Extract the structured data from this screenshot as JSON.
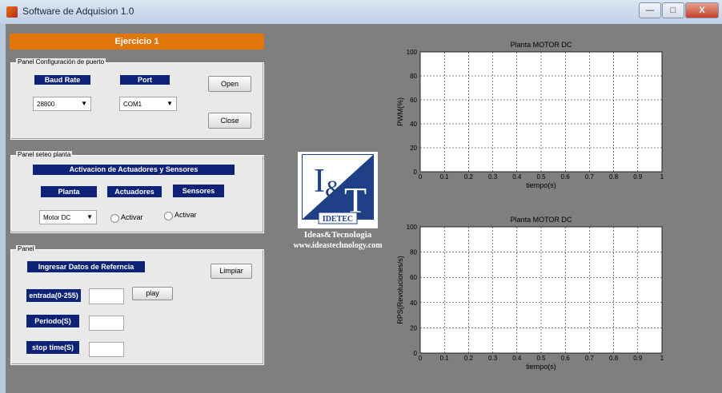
{
  "window": {
    "title": "Software de Adquision  1.0",
    "minimize": "—",
    "maximize": "□",
    "close": "X"
  },
  "banner": {
    "label": "Ejercicio 1"
  },
  "port_panel": {
    "title": "Panel Configuración de puerto",
    "baud_label": "Baud Rate",
    "port_label": "Port",
    "baud_value": "28800",
    "port_value": "COM1",
    "open_label": "Open",
    "close_label": "Close"
  },
  "plant_panel": {
    "title": "Panel seteo planta",
    "header": "Activacion de Actuadores y Sensores",
    "planta_label": "Planta",
    "actuadores_label": "Actuadores",
    "sensores_label": "Sensores",
    "planta_value": "Motor DC",
    "activar1": "Activar",
    "activar2": "Activar"
  },
  "data_panel": {
    "title": "Panel",
    "header": "Ingresar Datos de Referncia",
    "limpiar_label": "Limpiar",
    "entrada_label": "entrada(0-255)",
    "play_label": "play",
    "periodo_label": "Periodo(S)",
    "stop_label": "stop time(S)"
  },
  "logo": {
    "mark": "I&T",
    "inner_text": "IDETEC",
    "caption1": "Ideas&Tecnologia",
    "caption2": "www.ideastechnology.com"
  },
  "chart_data": [
    {
      "type": "line",
      "title": "Planta MOTOR DC",
      "xlabel": "tiempo(s)",
      "ylabel": "PWM(%)",
      "xlim": [
        0,
        1
      ],
      "ylim": [
        0,
        100
      ],
      "x_ticks": [
        "0",
        "0.1",
        "0.2",
        "0.3",
        "0.4",
        "0.5",
        "0.6",
        "0.7",
        "0.8",
        "0.9",
        "1"
      ],
      "y_ticks": [
        "0",
        "20",
        "40",
        "60",
        "80",
        "100"
      ],
      "grid": true,
      "series": []
    },
    {
      "type": "line",
      "title": "Planta MOTOR DC",
      "xlabel": "tiempo(s)",
      "ylabel": "RPS(Revoluciones/s)",
      "xlim": [
        0,
        1
      ],
      "ylim": [
        0,
        100
      ],
      "x_ticks": [
        "0",
        "0.1",
        "0.2",
        "0.3",
        "0.4",
        "0.5",
        "0.6",
        "0.7",
        "0.8",
        "0.9",
        "1"
      ],
      "y_ticks": [
        "0",
        "20",
        "40",
        "60",
        "80",
        "100"
      ],
      "grid": true,
      "series": []
    }
  ]
}
